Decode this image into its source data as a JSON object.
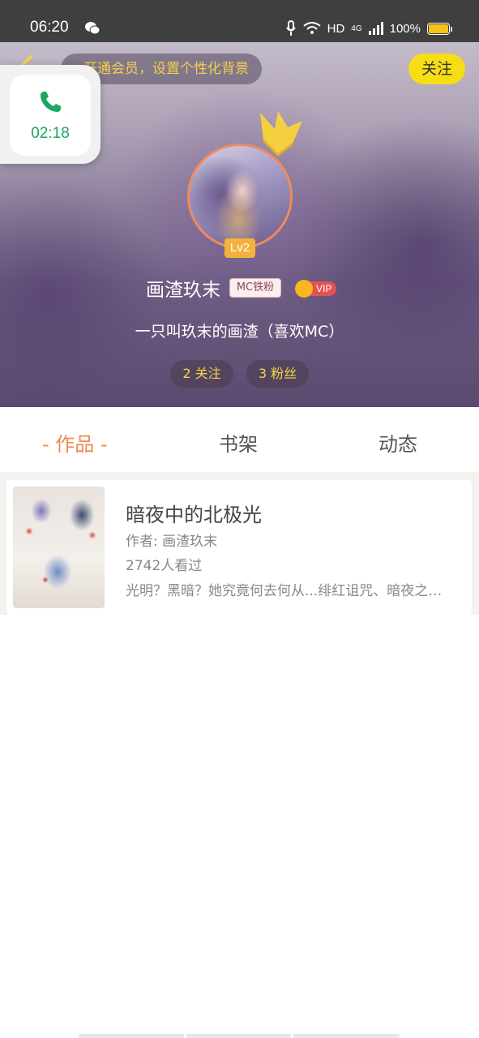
{
  "status_bar": {
    "time": "06:20",
    "network": "HD",
    "signal": "4G",
    "battery": "100%",
    "battery_color": "#f7c21b"
  },
  "header": {
    "vip_hint": "开通会员，设置个性化背景",
    "follow_label": "关注"
  },
  "call": {
    "duration": "02:18",
    "icon": "phone-icon",
    "color": "#1aa760"
  },
  "profile": {
    "level": "Lv2",
    "name": "画渣玖末",
    "fan_badge": "MC铁粉",
    "vip_label": "VIP",
    "signature": "一只叫玖末的画渣（喜欢MC）",
    "following": "2 关注",
    "fans": "3 粉丝"
  },
  "tabs": [
    {
      "label": "- 作品 -",
      "active": true
    },
    {
      "label": "书架",
      "active": false
    },
    {
      "label": "动态",
      "active": false
    }
  ],
  "works": [
    {
      "title": "暗夜中的北极光",
      "author": "作者: 画渣玖末",
      "views": "2742人看过",
      "description": "光明？黑暗？她究竟何去何从...绯红诅咒、暗夜之光、北极光"
    }
  ],
  "colors": {
    "accent": "#ec8a51",
    "follow_button": "#f6dd16",
    "stat_text": "#f6d640"
  }
}
